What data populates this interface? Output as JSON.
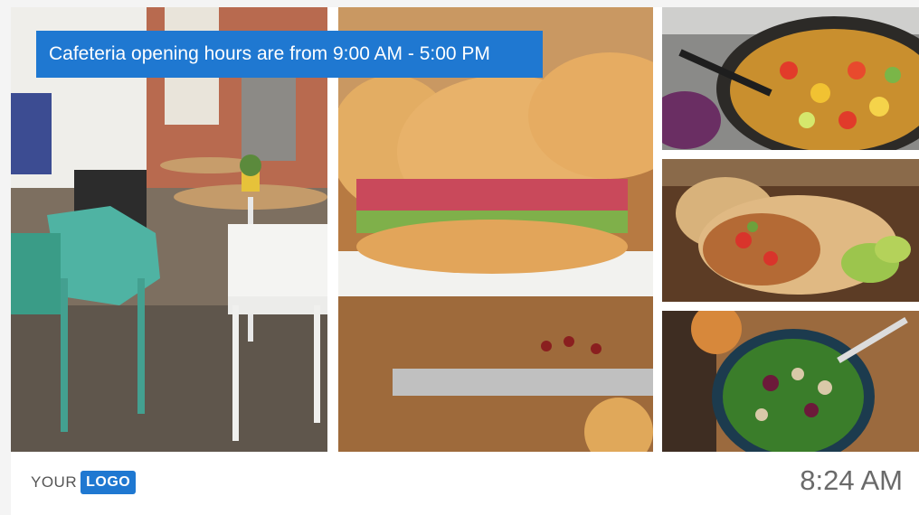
{
  "banner": {
    "text": "Cafeteria opening hours are from 9:00 AM - 5:00 PM"
  },
  "footer": {
    "logo_text": "YOUR",
    "logo_badge": "LOGO",
    "time": "8:24 AM"
  },
  "images": [
    {
      "name": "cafe-interior-photo"
    },
    {
      "name": "sandwich-photo"
    },
    {
      "name": "salad-bowl-photo"
    },
    {
      "name": "wrap-photo"
    },
    {
      "name": "green-salad-photo"
    }
  ],
  "colors": {
    "accent": "#1f78d1",
    "background": "#ffffff"
  }
}
